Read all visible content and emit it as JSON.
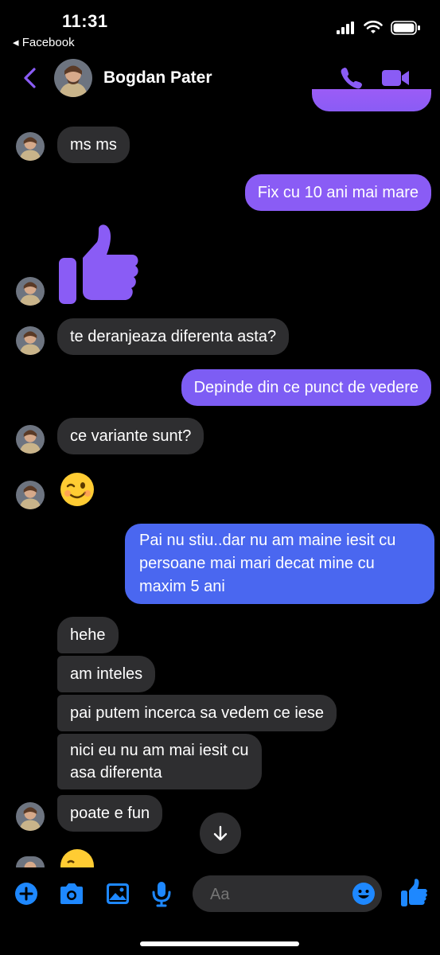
{
  "status_bar": {
    "time": "11:31",
    "back_app": "◂ Facebook"
  },
  "header": {
    "contact_name": "Bogdan Pater"
  },
  "messages": [
    {
      "side": "in",
      "text": "ms ms"
    },
    {
      "side": "out",
      "text": "Fix cu 10 ani mai mare"
    },
    {
      "side": "in",
      "type": "thumbs-up-icon"
    },
    {
      "side": "in",
      "text": "te deranjeaza diferenta asta?"
    },
    {
      "side": "out",
      "text": "Depinde din ce punct de vedere"
    },
    {
      "side": "in",
      "text": "ce variante sunt?"
    },
    {
      "side": "in",
      "type": "winking-face-emoji"
    },
    {
      "side": "out",
      "lines": [
        "Pai nu stiu..dar nu am maine iesit cu",
        "persoane mai mari decat mine cu",
        "maxim 5 ani"
      ]
    },
    {
      "side": "in",
      "text": "hehe"
    },
    {
      "side": "in",
      "text": "am inteles"
    },
    {
      "side": "in",
      "text": "pai putem incerca sa vedem ce iese"
    },
    {
      "side": "in",
      "lines": [
        "nici eu nu am mai iesit cu",
        "asa diferenta"
      ]
    },
    {
      "side": "in",
      "text": "poate e fun"
    }
  ],
  "composer": {
    "placeholder": "Aa"
  },
  "colors": {
    "accent": "#8a5cf5",
    "outgoing_gradient_top": "#8a5cf5",
    "outgoing_gradient_bottom": "#4a67f0",
    "incoming_bubble": "#2e2e30",
    "composer_icons": "#1e88ff"
  }
}
